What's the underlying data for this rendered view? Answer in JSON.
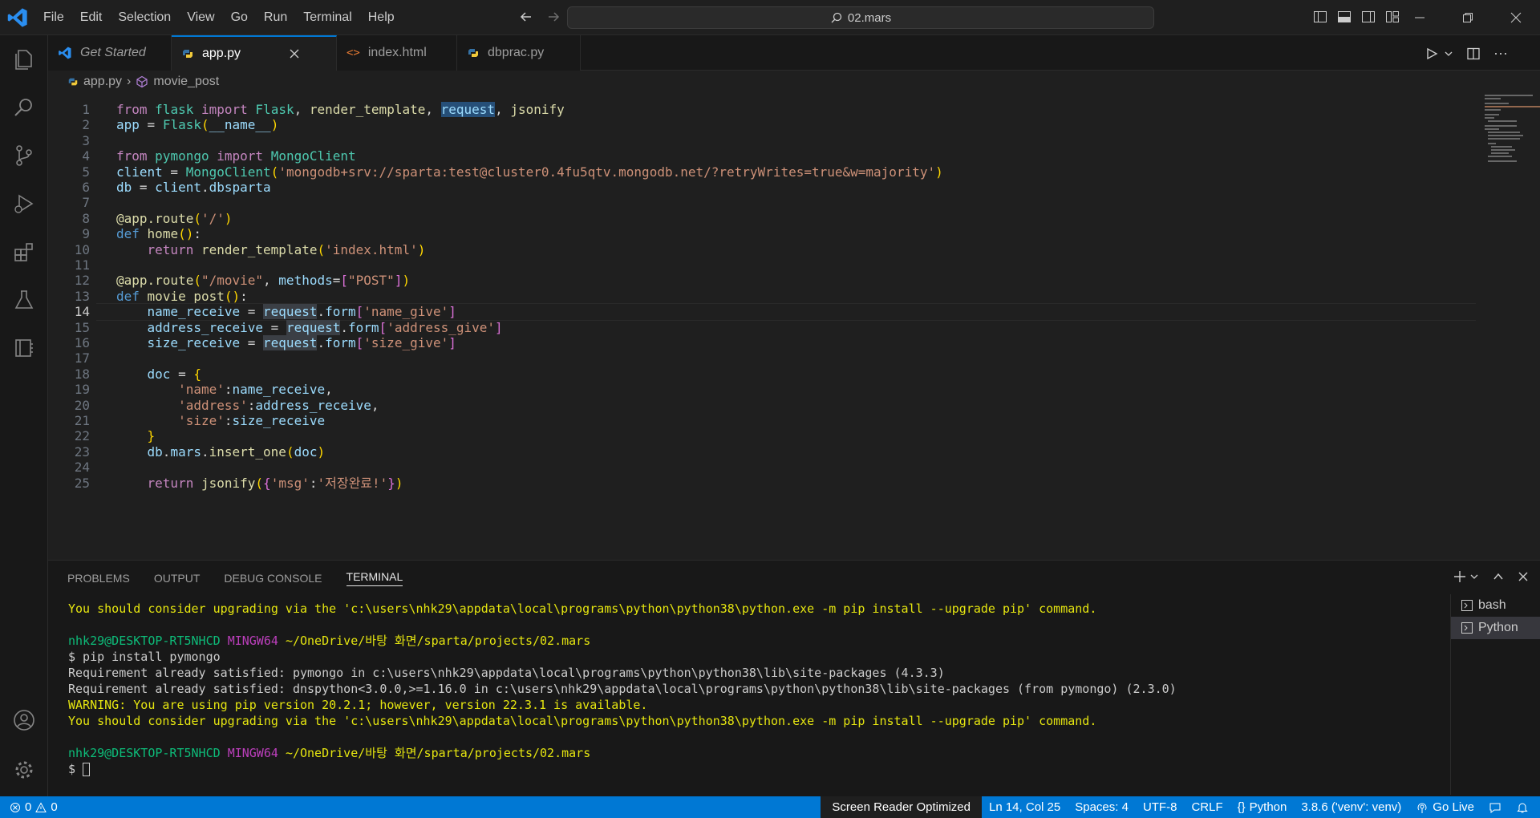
{
  "menu": [
    "File",
    "Edit",
    "Selection",
    "View",
    "Go",
    "Run",
    "Terminal",
    "Help"
  ],
  "search_text": "02.mars",
  "tabs": [
    {
      "label": "Get Started"
    },
    {
      "label": "app.py"
    },
    {
      "label": "index.html"
    },
    {
      "label": "dbprac.py"
    }
  ],
  "breadcrumb": {
    "file": "app.py",
    "symbol": "movie_post"
  },
  "editor": {
    "current_line": 14,
    "lines": [
      {
        "n": "1",
        "tokens": [
          [
            "c",
            "from"
          ],
          [
            "d",
            " "
          ],
          [
            "t",
            "flask"
          ],
          [
            "d",
            " "
          ],
          [
            "c",
            "import"
          ],
          [
            "d",
            " "
          ],
          [
            "t",
            "Flask"
          ],
          [
            "d",
            ", "
          ],
          [
            "f",
            "render_template"
          ],
          [
            "d",
            ", "
          ],
          [
            "hl2v",
            "request"
          ],
          [
            "d",
            ", "
          ],
          [
            "f",
            "jsonify"
          ]
        ]
      },
      {
        "n": "2",
        "tokens": [
          [
            "v",
            "app"
          ],
          [
            "d",
            " = "
          ],
          [
            "t",
            "Flask"
          ],
          [
            "b",
            "("
          ],
          [
            "v",
            "__name__"
          ],
          [
            "b",
            ")"
          ]
        ]
      },
      {
        "n": "3",
        "tokens": []
      },
      {
        "n": "4",
        "tokens": [
          [
            "c",
            "from"
          ],
          [
            "d",
            " "
          ],
          [
            "t",
            "pymongo"
          ],
          [
            "d",
            " "
          ],
          [
            "c",
            "import"
          ],
          [
            "d",
            " "
          ],
          [
            "t",
            "MongoClient"
          ]
        ]
      },
      {
        "n": "5",
        "tokens": [
          [
            "v",
            "client"
          ],
          [
            "d",
            " = "
          ],
          [
            "t",
            "MongoClient"
          ],
          [
            "b",
            "("
          ],
          [
            "s",
            "'mongodb+srv://sparta:test@cluster0.4fu5qtv.mongodb.net/?retryWrites=true&w=majority'"
          ],
          [
            "b",
            ")"
          ]
        ]
      },
      {
        "n": "6",
        "tokens": [
          [
            "v",
            "db"
          ],
          [
            "d",
            " = "
          ],
          [
            "v",
            "client"
          ],
          [
            "d",
            "."
          ],
          [
            "v",
            "dbsparta"
          ]
        ]
      },
      {
        "n": "7",
        "tokens": []
      },
      {
        "n": "8",
        "tokens": [
          [
            "f",
            "@app.route"
          ],
          [
            "b",
            "("
          ],
          [
            "s",
            "'/'"
          ],
          [
            "b",
            ")"
          ]
        ]
      },
      {
        "n": "9",
        "tokens": [
          [
            "k",
            "def"
          ],
          [
            "d",
            " "
          ],
          [
            "f",
            "home"
          ],
          [
            "b",
            "()"
          ],
          [
            "d",
            ":"
          ]
        ]
      },
      {
        "n": "10",
        "tokens": [
          [
            "d",
            "    "
          ],
          [
            "c",
            "return"
          ],
          [
            "d",
            " "
          ],
          [
            "f",
            "render_template"
          ],
          [
            "b",
            "("
          ],
          [
            "s",
            "'index.html'"
          ],
          [
            "b",
            ")"
          ]
        ]
      },
      {
        "n": "11",
        "tokens": []
      },
      {
        "n": "12",
        "tokens": [
          [
            "f",
            "@app.route"
          ],
          [
            "b",
            "("
          ],
          [
            "s",
            "\"/movie\""
          ],
          [
            "d",
            ", "
          ],
          [
            "v",
            "methods"
          ],
          [
            "d",
            "="
          ],
          [
            "p",
            "["
          ],
          [
            "s",
            "\"POST\""
          ],
          [
            "p",
            "]"
          ],
          [
            "b",
            ")"
          ]
        ]
      },
      {
        "n": "13",
        "tokens": [
          [
            "k",
            "def"
          ],
          [
            "d",
            " "
          ],
          [
            "f",
            "movie_post"
          ],
          [
            "b",
            "()"
          ],
          [
            "d",
            ":"
          ]
        ]
      },
      {
        "n": "14",
        "tokens": [
          [
            "d",
            "    "
          ],
          [
            "v",
            "name_receive"
          ],
          [
            "d",
            " = "
          ],
          [
            "hlv",
            "request"
          ],
          [
            "d",
            "."
          ],
          [
            "v",
            "form"
          ],
          [
            "p",
            "["
          ],
          [
            "s",
            "'name_give'"
          ],
          [
            "p",
            "]"
          ]
        ]
      },
      {
        "n": "15",
        "tokens": [
          [
            "d",
            "    "
          ],
          [
            "v",
            "address_receive"
          ],
          [
            "d",
            " = "
          ],
          [
            "hlv",
            "request"
          ],
          [
            "d",
            "."
          ],
          [
            "v",
            "form"
          ],
          [
            "p",
            "["
          ],
          [
            "s",
            "'address_give'"
          ],
          [
            "p",
            "]"
          ]
        ]
      },
      {
        "n": "16",
        "tokens": [
          [
            "d",
            "    "
          ],
          [
            "v",
            "size_receive"
          ],
          [
            "d",
            " = "
          ],
          [
            "hlv",
            "request"
          ],
          [
            "d",
            "."
          ],
          [
            "v",
            "form"
          ],
          [
            "p",
            "["
          ],
          [
            "s",
            "'size_give'"
          ],
          [
            "p",
            "]"
          ]
        ]
      },
      {
        "n": "17",
        "tokens": []
      },
      {
        "n": "18",
        "tokens": [
          [
            "d",
            "    "
          ],
          [
            "v",
            "doc"
          ],
          [
            "d",
            " = "
          ],
          [
            "b",
            "{"
          ]
        ]
      },
      {
        "n": "19",
        "tokens": [
          [
            "d",
            "        "
          ],
          [
            "s",
            "'name'"
          ],
          [
            "d",
            ":"
          ],
          [
            "v",
            "name_receive"
          ],
          [
            "d",
            ","
          ]
        ]
      },
      {
        "n": "20",
        "tokens": [
          [
            "d",
            "        "
          ],
          [
            "s",
            "'address'"
          ],
          [
            "d",
            ":"
          ],
          [
            "v",
            "address_receive"
          ],
          [
            "d",
            ","
          ]
        ]
      },
      {
        "n": "21",
        "tokens": [
          [
            "d",
            "        "
          ],
          [
            "s",
            "'size'"
          ],
          [
            "d",
            ":"
          ],
          [
            "v",
            "size_receive"
          ]
        ]
      },
      {
        "n": "22",
        "tokens": [
          [
            "d",
            "    "
          ],
          [
            "b",
            "}"
          ]
        ]
      },
      {
        "n": "23",
        "tokens": [
          [
            "d",
            "    "
          ],
          [
            "v",
            "db"
          ],
          [
            "d",
            "."
          ],
          [
            "v",
            "mars"
          ],
          [
            "d",
            "."
          ],
          [
            "f",
            "insert_one"
          ],
          [
            "b",
            "("
          ],
          [
            "v",
            "doc"
          ],
          [
            "b",
            ")"
          ]
        ]
      },
      {
        "n": "24",
        "tokens": []
      },
      {
        "n": "25",
        "tokens": [
          [
            "d",
            "    "
          ],
          [
            "c",
            "return"
          ],
          [
            "d",
            " "
          ],
          [
            "f",
            "jsonify"
          ],
          [
            "b",
            "("
          ],
          [
            "p",
            "{"
          ],
          [
            "s",
            "'msg'"
          ],
          [
            "d",
            ":"
          ],
          [
            "s",
            "'저장완료!'"
          ],
          [
            "p",
            "}"
          ],
          [
            "b",
            ")"
          ]
        ]
      }
    ]
  },
  "panel": {
    "tabs": [
      "PROBLEMS",
      "OUTPUT",
      "DEBUG CONSOLE",
      "TERMINAL"
    ],
    "active_tab": "TERMINAL",
    "terminal_lines": [
      [
        [
          "ty",
          "You should consider upgrading via the 'c:\\users\\nhk29\\appdata\\local\\programs\\python\\python38\\python.exe -m pip install --upgrade pip' command."
        ]
      ],
      [],
      [
        [
          "tg",
          "nhk29@DESKTOP-RT5NHCD"
        ],
        [
          "tw",
          " "
        ],
        [
          "tm",
          "MINGW64"
        ],
        [
          "tw",
          " "
        ],
        [
          "ty",
          "~/OneDrive/바탕 화면/sparta/projects/02.mars"
        ]
      ],
      [
        [
          "tw",
          "$ pip install pymongo"
        ]
      ],
      [
        [
          "tw",
          "Requirement already satisfied: pymongo in c:\\users\\nhk29\\appdata\\local\\programs\\python\\python38\\lib\\site-packages (4.3.3)"
        ]
      ],
      [
        [
          "tw",
          "Requirement already satisfied: dnspython<3.0.0,>=1.16.0 in c:\\users\\nhk29\\appdata\\local\\programs\\python\\python38\\lib\\site-packages (from pymongo) (2.3.0)"
        ]
      ],
      [
        [
          "ty",
          "WARNING: You are using pip version 20.2.1; however, version 22.3.1 is available."
        ]
      ],
      [
        [
          "ty",
          "You should consider upgrading via the 'c:\\users\\nhk29\\appdata\\local\\programs\\python\\python38\\python.exe -m pip install --upgrade pip' command."
        ]
      ],
      [],
      [
        [
          "tg",
          "nhk29@DESKTOP-RT5NHCD"
        ],
        [
          "tw",
          " "
        ],
        [
          "tm",
          "MINGW64"
        ],
        [
          "tw",
          " "
        ],
        [
          "ty",
          "~/OneDrive/바탕 화면/sparta/projects/02.mars"
        ]
      ],
      [
        [
          "tw",
          "$ "
        ]
      ]
    ],
    "terminals": [
      "bash",
      "Python"
    ],
    "active_terminal": "Python"
  },
  "status": {
    "errors": "0",
    "warnings": "0",
    "screen_reader": "Screen Reader Optimized",
    "position": "Ln 14, Col 25",
    "spaces": "Spaces: 4",
    "encoding": "UTF-8",
    "eol": "CRLF",
    "language": "Python",
    "interpreter": "3.8.6 ('venv': venv)",
    "go_live": "Go Live"
  },
  "colors": {
    "accent": "#0078d4",
    "statusbar": "#0078d4",
    "background": "#1f1f1f"
  }
}
